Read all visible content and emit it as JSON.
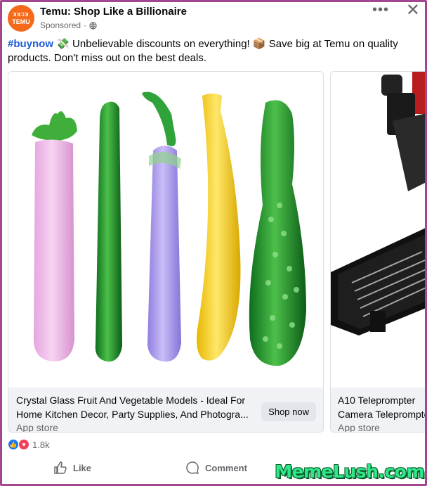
{
  "post": {
    "page_name": "Temu: Shop Like a Billionaire",
    "sponsored": "Sponsored",
    "separator": "·",
    "avatar": {
      "logo_top": "ꓘꓘꓛꓘ",
      "logo_main": "TEMU",
      "color": "#f56a1a"
    },
    "more_icon": "more-icon",
    "close_icon": "close-icon",
    "caption": {
      "hashtag": "#buynow",
      "text": "Unbelievable discounts on everything!",
      "text2": "Save big at Temu on quality products. Don't miss out on the best deals."
    }
  },
  "carousel": {
    "cards": [
      {
        "title_line1": "Crystal Glass Fruit And Vegetable Models - Ideal For",
        "title_line2": "Home Kitchen Decor, Party Supplies, And Photogra...",
        "source": "App store",
        "cta": "Shop now"
      },
      {
        "title_line1": "A10 Teleprompter",
        "title_line2": "Camera Teleprompter",
        "source": "App store"
      }
    ]
  },
  "reactions": {
    "count": "1.8k"
  },
  "actions": {
    "like": "Like",
    "comment": "Comment"
  },
  "watermark": "MemeLush.com",
  "colors": {
    "hashtag": "#1d5bd6",
    "frame": "#a2478f",
    "like": "#1877f2",
    "love": "#f33e58"
  }
}
